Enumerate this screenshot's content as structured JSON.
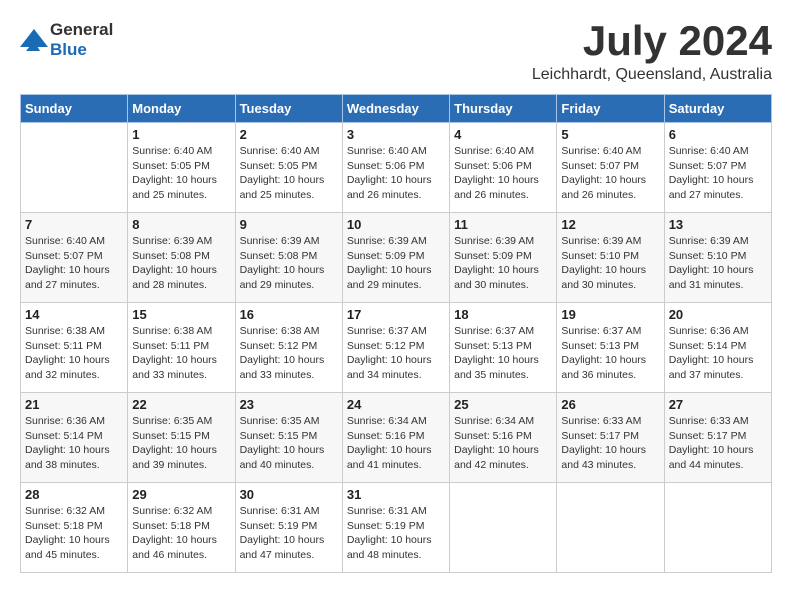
{
  "logo": {
    "text_general": "General",
    "text_blue": "Blue"
  },
  "title": {
    "month_year": "July 2024",
    "location": "Leichhardt, Queensland, Australia"
  },
  "calendar": {
    "headers": [
      "Sunday",
      "Monday",
      "Tuesday",
      "Wednesday",
      "Thursday",
      "Friday",
      "Saturday"
    ],
    "weeks": [
      [
        {
          "day": "",
          "info": ""
        },
        {
          "day": "1",
          "info": "Sunrise: 6:40 AM\nSunset: 5:05 PM\nDaylight: 10 hours\nand 25 minutes."
        },
        {
          "day": "2",
          "info": "Sunrise: 6:40 AM\nSunset: 5:05 PM\nDaylight: 10 hours\nand 25 minutes."
        },
        {
          "day": "3",
          "info": "Sunrise: 6:40 AM\nSunset: 5:06 PM\nDaylight: 10 hours\nand 26 minutes."
        },
        {
          "day": "4",
          "info": "Sunrise: 6:40 AM\nSunset: 5:06 PM\nDaylight: 10 hours\nand 26 minutes."
        },
        {
          "day": "5",
          "info": "Sunrise: 6:40 AM\nSunset: 5:07 PM\nDaylight: 10 hours\nand 26 minutes."
        },
        {
          "day": "6",
          "info": "Sunrise: 6:40 AM\nSunset: 5:07 PM\nDaylight: 10 hours\nand 27 minutes."
        }
      ],
      [
        {
          "day": "7",
          "info": "Sunrise: 6:40 AM\nSunset: 5:07 PM\nDaylight: 10 hours\nand 27 minutes."
        },
        {
          "day": "8",
          "info": "Sunrise: 6:39 AM\nSunset: 5:08 PM\nDaylight: 10 hours\nand 28 minutes."
        },
        {
          "day": "9",
          "info": "Sunrise: 6:39 AM\nSunset: 5:08 PM\nDaylight: 10 hours\nand 29 minutes."
        },
        {
          "day": "10",
          "info": "Sunrise: 6:39 AM\nSunset: 5:09 PM\nDaylight: 10 hours\nand 29 minutes."
        },
        {
          "day": "11",
          "info": "Sunrise: 6:39 AM\nSunset: 5:09 PM\nDaylight: 10 hours\nand 30 minutes."
        },
        {
          "day": "12",
          "info": "Sunrise: 6:39 AM\nSunset: 5:10 PM\nDaylight: 10 hours\nand 30 minutes."
        },
        {
          "day": "13",
          "info": "Sunrise: 6:39 AM\nSunset: 5:10 PM\nDaylight: 10 hours\nand 31 minutes."
        }
      ],
      [
        {
          "day": "14",
          "info": "Sunrise: 6:38 AM\nSunset: 5:11 PM\nDaylight: 10 hours\nand 32 minutes."
        },
        {
          "day": "15",
          "info": "Sunrise: 6:38 AM\nSunset: 5:11 PM\nDaylight: 10 hours\nand 33 minutes."
        },
        {
          "day": "16",
          "info": "Sunrise: 6:38 AM\nSunset: 5:12 PM\nDaylight: 10 hours\nand 33 minutes."
        },
        {
          "day": "17",
          "info": "Sunrise: 6:37 AM\nSunset: 5:12 PM\nDaylight: 10 hours\nand 34 minutes."
        },
        {
          "day": "18",
          "info": "Sunrise: 6:37 AM\nSunset: 5:13 PM\nDaylight: 10 hours\nand 35 minutes."
        },
        {
          "day": "19",
          "info": "Sunrise: 6:37 AM\nSunset: 5:13 PM\nDaylight: 10 hours\nand 36 minutes."
        },
        {
          "day": "20",
          "info": "Sunrise: 6:36 AM\nSunset: 5:14 PM\nDaylight: 10 hours\nand 37 minutes."
        }
      ],
      [
        {
          "day": "21",
          "info": "Sunrise: 6:36 AM\nSunset: 5:14 PM\nDaylight: 10 hours\nand 38 minutes."
        },
        {
          "day": "22",
          "info": "Sunrise: 6:35 AM\nSunset: 5:15 PM\nDaylight: 10 hours\nand 39 minutes."
        },
        {
          "day": "23",
          "info": "Sunrise: 6:35 AM\nSunset: 5:15 PM\nDaylight: 10 hours\nand 40 minutes."
        },
        {
          "day": "24",
          "info": "Sunrise: 6:34 AM\nSunset: 5:16 PM\nDaylight: 10 hours\nand 41 minutes."
        },
        {
          "day": "25",
          "info": "Sunrise: 6:34 AM\nSunset: 5:16 PM\nDaylight: 10 hours\nand 42 minutes."
        },
        {
          "day": "26",
          "info": "Sunrise: 6:33 AM\nSunset: 5:17 PM\nDaylight: 10 hours\nand 43 minutes."
        },
        {
          "day": "27",
          "info": "Sunrise: 6:33 AM\nSunset: 5:17 PM\nDaylight: 10 hours\nand 44 minutes."
        }
      ],
      [
        {
          "day": "28",
          "info": "Sunrise: 6:32 AM\nSunset: 5:18 PM\nDaylight: 10 hours\nand 45 minutes."
        },
        {
          "day": "29",
          "info": "Sunrise: 6:32 AM\nSunset: 5:18 PM\nDaylight: 10 hours\nand 46 minutes."
        },
        {
          "day": "30",
          "info": "Sunrise: 6:31 AM\nSunset: 5:19 PM\nDaylight: 10 hours\nand 47 minutes."
        },
        {
          "day": "31",
          "info": "Sunrise: 6:31 AM\nSunset: 5:19 PM\nDaylight: 10 hours\nand 48 minutes."
        },
        {
          "day": "",
          "info": ""
        },
        {
          "day": "",
          "info": ""
        },
        {
          "day": "",
          "info": ""
        }
      ]
    ]
  }
}
